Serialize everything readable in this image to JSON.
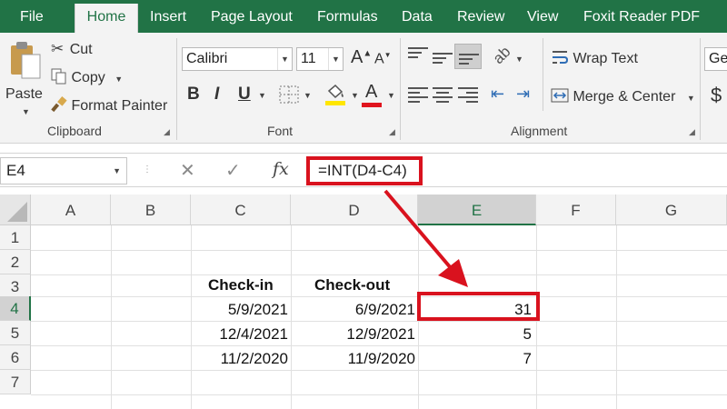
{
  "menu": {
    "tabs": [
      "File",
      "Home",
      "Insert",
      "Page Layout",
      "Formulas",
      "Data",
      "Review",
      "View",
      "Foxit Reader PDF"
    ]
  },
  "ribbon": {
    "clipboard": {
      "paste": "Paste",
      "cut": "Cut",
      "copy": "Copy",
      "format_painter": "Format Painter",
      "group_label": "Clipboard"
    },
    "font": {
      "font_name": "Calibri",
      "font_size": "11",
      "bold": "B",
      "italic": "I",
      "underline": "U",
      "grow": "A",
      "shrink": "A",
      "font_color_letter": "A",
      "group_label": "Font"
    },
    "alignment": {
      "wrap_text": "Wrap Text",
      "merge_center": "Merge & Center",
      "group_label": "Alignment"
    },
    "number": {
      "format_value": "Ger",
      "currency": "$"
    }
  },
  "formula_bar": {
    "name_box": "E4",
    "cancel": "✕",
    "enter": "✓",
    "fx": "fx",
    "formula": "=INT(D4-C4)"
  },
  "sheet": {
    "columns": [
      "A",
      "B",
      "C",
      "D",
      "E",
      "F",
      "G"
    ],
    "rows": [
      "1",
      "2",
      "3",
      "4",
      "5",
      "6",
      "7"
    ],
    "active_cell": "E4",
    "cells": {
      "C3": "Check-in",
      "D3": "Check-out",
      "C4": "5/9/2021",
      "D4": "6/9/2021",
      "E4": "31",
      "C5": "12/4/2021",
      "D5": "12/9/2021",
      "E5": "5",
      "C6": "11/2/2020",
      "D6": "11/9/2020",
      "E6": "7"
    }
  },
  "colors": {
    "excel_green": "#217346",
    "annotation_red": "#d9121e",
    "highlight_yellow": "#ffe600",
    "font_red": "#e0141e"
  }
}
